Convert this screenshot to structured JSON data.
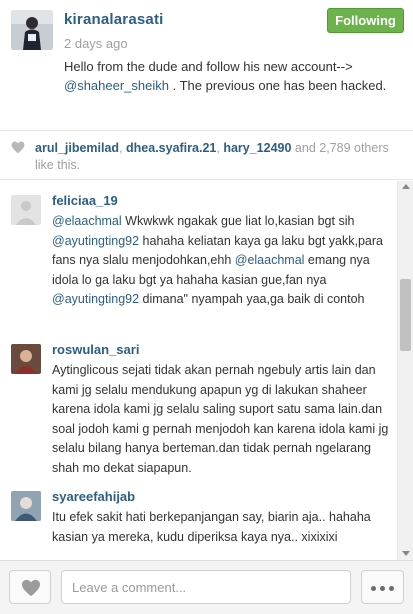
{
  "post": {
    "owner": "kiranalarasati",
    "time": "2 days ago",
    "follow_label": "Following",
    "caption": {
      "line1": "Hello from the dude and follow his new account-->",
      "mention": "@shaheer_sheikh",
      "rest": " . The previous one has been hacked."
    }
  },
  "likes": {
    "users": [
      "arul_jibemilad",
      "dhea.syafira.21",
      "hary_12490"
    ],
    "sep1": ", ",
    "sep2": ", ",
    "and_text": " and ",
    "count": "2,789",
    "suffix": " others like this."
  },
  "comments": [
    {
      "user": "feliciaa_19",
      "parts": [
        {
          "t": "@elaachmal",
          "m": true
        },
        {
          "t": " Wkwkwk ngakak gue liat lo,kasian bgt sih "
        },
        {
          "t": "@ayutingting92",
          "m": true
        },
        {
          "t": " hahaha keliatan kaya ga laku bgt yakk,para fans nya slalu menjodohkan,ehh "
        },
        {
          "t": "@elaachmal",
          "m": true
        },
        {
          "t": " emang nya idola lo ga laku bgt ya hahaha kasian gue,fan nya "
        },
        {
          "t": "@ayutingting92",
          "m": true
        },
        {
          "t": " dimana\" nyampah yaa,ga baik di contoh"
        }
      ]
    },
    {
      "user": "roswulan_sari",
      "parts": [
        {
          "t": "Aytinglicous sejati tidak akan pernah ngebuly artis lain dan kami jg selalu mendukung apapun yg di lakukan shaheer karena idola kami jg selalu saling suport satu sama lain.dan soal jodoh kami g pernah menjodoh kan karena idola kami jg selalu bilang hanya berteman.dan tidak pernah ngelarang shah mo dekat siapapun."
        }
      ]
    },
    {
      "user": "syareefahijab",
      "parts": [
        {
          "t": "Itu efek sakit hati berkepanjangan say, biarin aja.. hahaha kasian ya mereka, kudu diperiksa kaya nya.. xixixixi"
        }
      ]
    }
  ],
  "footer": {
    "comment_placeholder": "Leave a comment..."
  },
  "icons": {
    "heart": "heart-icon",
    "more": "more-dots-icon"
  },
  "colors": {
    "username": "#2c5e86",
    "follow_green": "#6bb34a",
    "muted": "#a0a0a0"
  }
}
